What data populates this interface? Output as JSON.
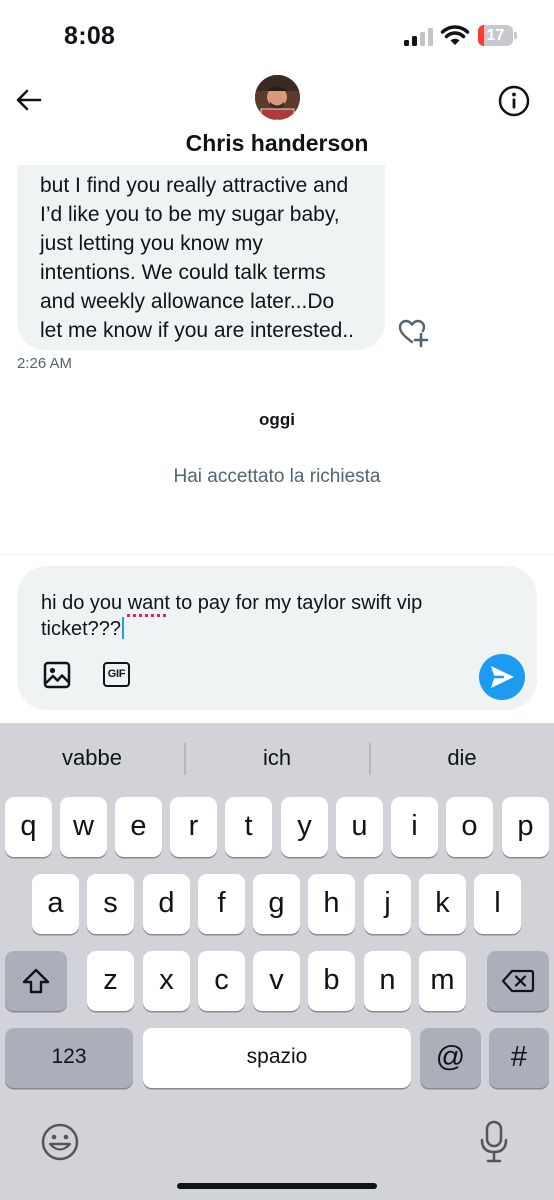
{
  "status_bar": {
    "time": "8:08",
    "battery_level": "17",
    "battery_fraction": 0.17,
    "battery_color": "#ff3b30"
  },
  "header": {
    "contact_name": "Chris handerson",
    "back_icon": "arrow-left-icon",
    "info_icon": "info-circle-icon"
  },
  "conversation": {
    "message_text": "but I find you really attractive and\nI’d like you to be my sugar baby,\njust letting you know my\nintentions. We could talk terms\nand weekly allowance later...Do\nlet me know if you are interested..",
    "message_time": "2:26 AM",
    "day_label": "oggi",
    "system_message": "Hai accettato la richiesta"
  },
  "composer": {
    "text_before": "hi do you ",
    "text_misspelled": "want",
    "text_after": " to pay for my taylor swift vip ticket???",
    "gif_label": "GIF",
    "send_color": "#1d9bf0"
  },
  "keyboard": {
    "suggestions": [
      "vabbe",
      "ich",
      "die"
    ],
    "row1": [
      "q",
      "w",
      "e",
      "r",
      "t",
      "y",
      "u",
      "i",
      "o",
      "p"
    ],
    "row2": [
      "a",
      "s",
      "d",
      "f",
      "g",
      "h",
      "j",
      "k",
      "l"
    ],
    "row3": [
      "z",
      "x",
      "c",
      "v",
      "b",
      "n",
      "m"
    ],
    "numbers_label": "123",
    "space_label": "spazio",
    "at_label": "@",
    "hash_label": "#"
  }
}
